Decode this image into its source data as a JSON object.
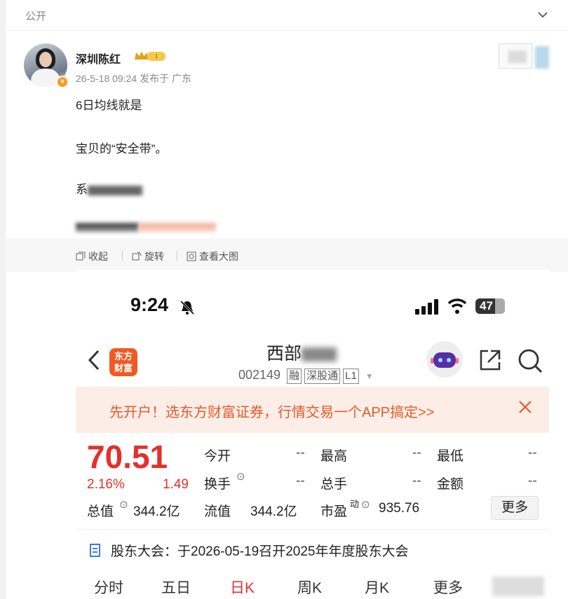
{
  "header": {
    "visibility": "公开"
  },
  "post": {
    "author": "深圳陈红",
    "level_badge": "I",
    "meta": "26-5-18 09:24 发布于 广东",
    "lines": [
      "6日均线就是",
      "宝贝的“安全带”。",
      "系"
    ]
  },
  "toolbar": {
    "collapse": "收起",
    "rotate": "旋转",
    "view_large": "查看大图"
  },
  "app": {
    "status_time": "9:24",
    "battery": "47",
    "broker_logo_line1": "东方",
    "broker_logo_line2": "财富",
    "stock_name": "西部",
    "stock_code": "002149",
    "tags": [
      "融",
      "深股通",
      "L1"
    ],
    "banner": "先开户！选东方财富证券，行情交易一个APP搞定>>",
    "price": "70.51",
    "change_pct": "2.16%",
    "change_amt": "1.49",
    "quote": {
      "open_label": "今开",
      "open": "--",
      "high_label": "最高",
      "high": "--",
      "low_label": "最低",
      "low": "--",
      "turnover_label": "换手",
      "turnover": "--",
      "volume_label": "总手",
      "volume": "--",
      "amount_label": "金额",
      "amount": "--",
      "mcap_label": "总值",
      "mcap": "344.2亿",
      "float_label": "流值",
      "float": "344.2亿",
      "pe_label": "市盈",
      "pe_sup": "动",
      "pe": "935.76"
    },
    "more": "更多",
    "meeting": "股东大会：于2026-05-19召开2025年年度股东大会",
    "tabs": [
      "分时",
      "五日",
      "日K",
      "周K",
      "月K",
      "更多"
    ],
    "active_tab": "日K"
  }
}
